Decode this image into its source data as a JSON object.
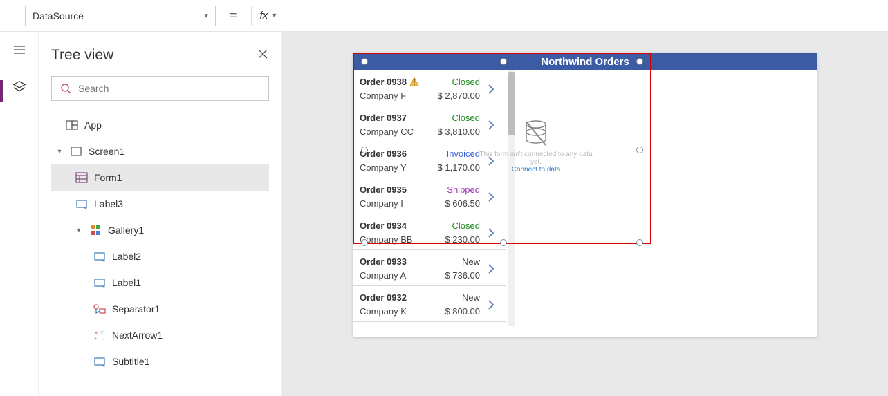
{
  "formula_bar": {
    "property": "DataSource",
    "formula_value": ""
  },
  "tree": {
    "title": "Tree view",
    "search_placeholder": "Search",
    "items": {
      "app": "App",
      "screen1": "Screen1",
      "form1": "Form1",
      "label3": "Label3",
      "gallery1": "Gallery1",
      "label2": "Label2",
      "label1": "Label1",
      "separator1": "Separator1",
      "nextarrow1": "NextArrow1",
      "subtitle1": "Subtitle1"
    }
  },
  "canvas": {
    "header_title": "Northwind Orders",
    "placeholder_line": "This form isn't connected to any data yet.",
    "placeholder_link": "Connect to data",
    "orders": [
      {
        "title": "Order 0938",
        "warn": true,
        "company": "Company F",
        "status": "Closed",
        "amount": "$ 2,870.00"
      },
      {
        "title": "Order 0937",
        "company": "Company CC",
        "status": "Closed",
        "amount": "$ 3,810.00"
      },
      {
        "title": "Order 0936",
        "company": "Company Y",
        "status": "Invoiced",
        "amount": "$ 1,170.00"
      },
      {
        "title": "Order 0935",
        "company": "Company I",
        "status": "Shipped",
        "amount": "$ 606.50"
      },
      {
        "title": "Order 0934",
        "company": "Company BB",
        "status": "Closed",
        "amount": "$ 230.00"
      },
      {
        "title": "Order 0933",
        "company": "Company A",
        "status": "New",
        "amount": "$ 736.00"
      },
      {
        "title": "Order 0932",
        "company": "Company K",
        "status": "New",
        "amount": "$ 800.00"
      }
    ]
  }
}
